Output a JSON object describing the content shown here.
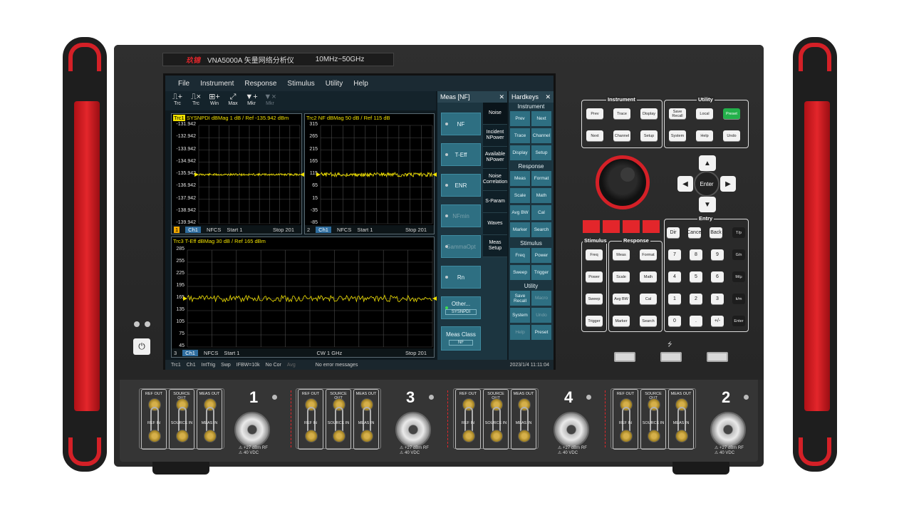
{
  "brand": {
    "logo": "玖锦",
    "model": "VNA5000A 矢量网络分析仪",
    "range": "10MHz~50GHz"
  },
  "menu": [
    "File",
    "Instrument",
    "Response",
    "Stimulus",
    "Utility",
    "Help"
  ],
  "toolbar": [
    {
      "icon": "trace-add-icon",
      "label": "Trc",
      "glyph": "⎍+"
    },
    {
      "icon": "trace-remove-icon",
      "label": "Trc",
      "glyph": "⎍×"
    },
    {
      "icon": "window-add-icon",
      "label": "Win",
      "glyph": "⊞+"
    },
    {
      "icon": "maximize-icon",
      "label": "Max",
      "glyph": "⤢"
    },
    {
      "icon": "marker-add-icon",
      "label": "Mkr",
      "glyph": "▼+"
    },
    {
      "icon": "marker-remove-icon",
      "label": "Mkr",
      "glyph": "▼×"
    }
  ],
  "plots": {
    "trc1": {
      "tag": "Trc1",
      "title": " SYSNPDI dBMag 1 dB / Ref -135.942 dBm",
      "yticks": [
        "-131.942",
        "-132.942",
        "-133.942",
        "-134.942",
        "-135.942",
        "-136.942",
        "-137.942",
        "-138.942",
        "-139.942"
      ],
      "foot": {
        "num": "1",
        "ch": "Ch1",
        "mode": "NFCS",
        "start": "Start 1",
        "stop": "Stop 201"
      }
    },
    "trc2": {
      "title": "Trc2  NF dBMag 50 dB / Ref 115 dB",
      "yticks": [
        "315",
        "265",
        "215",
        "165",
        "115",
        "65",
        "15",
        "-35",
        "-85"
      ],
      "foot": {
        "num": "2",
        "ch": "Ch1",
        "mode": "NFCS",
        "start": "Start 1",
        "stop": "Stop 201"
      }
    },
    "trc3": {
      "title": "Trc3  T-Eff dBMag 30 dB / Ref 165 dBm",
      "yticks": [
        "285",
        "255",
        "225",
        "195",
        "165",
        "135",
        "105",
        "75",
        "45"
      ],
      "foot": {
        "num": "3",
        "ch": "Ch1",
        "mode": "NFCS",
        "start": "Start 1",
        "center": "CW 1 GHz",
        "stop": "Stop 201"
      }
    }
  },
  "statusbar": {
    "trc": "Trc1",
    "ch": "Ch1",
    "trig": "IntTrig",
    "swp": "Swp",
    "bw": "IFBW=10k",
    "cor": "No Cor",
    "avg": "Avg",
    "msg": "No error messages",
    "datetime": "2023/1/4 11:11:04"
  },
  "meas": {
    "title": "Meas [NF]",
    "close": "✕",
    "buttons": [
      {
        "label": "NF",
        "enabled": true
      },
      {
        "label": "T-Eff",
        "enabled": true
      },
      {
        "label": "ENR",
        "enabled": true
      },
      {
        "label": "NFmin",
        "enabled": false
      },
      {
        "label": "GammaOpt",
        "enabled": false
      },
      {
        "label": "Rn",
        "enabled": true
      }
    ],
    "other": {
      "label": "Other...",
      "value": "SYSNPDI"
    },
    "measclass": {
      "label": "Meas Class",
      "value": "NF"
    },
    "tabs": [
      "Noise",
      "Incident NPower",
      "Available NPower",
      "Noise Correlation",
      "S-Param",
      "Waves",
      "Meas Setup"
    ]
  },
  "hardkeys": {
    "title": "Hardkeys",
    "close": "✕",
    "sections": [
      {
        "name": "Instrument",
        "keys": [
          [
            "Prev",
            "Next"
          ],
          [
            "Trace",
            "Channel"
          ],
          [
            "Display",
            "Setup"
          ]
        ]
      },
      {
        "name": "Response",
        "keys": [
          [
            "Meas",
            "Format"
          ],
          [
            "Scale",
            "Math"
          ],
          [
            "Avg BW",
            "Cal"
          ],
          [
            "Marker",
            "Search"
          ]
        ]
      },
      {
        "name": "Stimulus",
        "keys": [
          [
            "Freq",
            "Power"
          ],
          [
            "Sweep",
            "Trigger"
          ]
        ]
      },
      {
        "name": "Utility",
        "keys": [
          [
            "Save Recall",
            "Macro"
          ],
          [
            "System",
            "Undo"
          ],
          [
            "Help",
            "Preset"
          ]
        ]
      }
    ]
  },
  "front": {
    "instrument": {
      "label": "Instrument",
      "keys": [
        "Prev",
        "Trace",
        "Display",
        "Next",
        "Channel",
        "Setup"
      ]
    },
    "utility": {
      "label": "Utility",
      "keys": [
        "Save Recall",
        "Local",
        "Preset",
        "System",
        "Help",
        "Undo"
      ]
    },
    "enter": "Enter",
    "stimulus": {
      "label": "Stimulus",
      "keys": [
        "Freq",
        "Power",
        "Sweep",
        "Trigger"
      ]
    },
    "response": {
      "label": "Response",
      "keys": [
        "Meas",
        "Format",
        "Scale",
        "Math",
        "Avg BW",
        "Cal",
        "Marker",
        "Search"
      ]
    },
    "entry": {
      "label": "Entry",
      "top": [
        "Dir",
        "Cancel",
        "Back"
      ],
      "nums": [
        "7",
        "8",
        "9",
        "4",
        "5",
        "6",
        "1",
        "2",
        "3",
        "0",
        ".",
        "+/-"
      ],
      "units": [
        "T/p",
        "G/n",
        "M/μ",
        "k/m",
        "Enter"
      ]
    }
  },
  "ports": {
    "numbers": [
      "1",
      "3",
      "4",
      "2"
    ],
    "colhdrs": [
      "REF OUT",
      "SOURCE OUT",
      "MEAS OUT"
    ],
    "colins": [
      "REF IN",
      "SOURCE IN",
      "MEAS IN"
    ],
    "rating": "+27 dBm RF",
    "vdc": "40 VDC"
  }
}
